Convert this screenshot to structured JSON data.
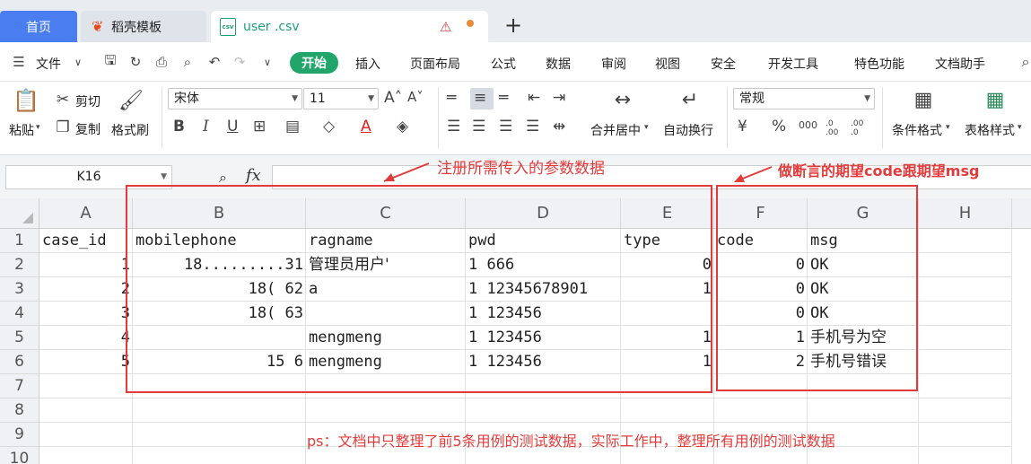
{
  "tabs": {
    "home": "首页",
    "template": "稻壳模板",
    "file": "user .csv",
    "file_icon_text": "csv"
  },
  "menu": {
    "file": "文件",
    "items": [
      "开始",
      "插入",
      "页面布局",
      "公式",
      "数据",
      "审阅",
      "视图",
      "安全",
      "开发工具",
      "特色功能",
      "文档助手"
    ]
  },
  "ribbon": {
    "paste": "粘贴",
    "cut": "剪切",
    "copy": "复制",
    "format_painter": "格式刷",
    "font_name": "宋体",
    "font_size": "11",
    "merge_center": "合并居中",
    "wrap_text": "自动换行",
    "number_format": "常规",
    "conditional_format": "条件格式",
    "table_style": "表格样式",
    "percent_symbol": "%",
    "thousands": "000",
    "inc_decimal": ".0 .00",
    "dec_decimal": ".00 .0"
  },
  "formula_bar": {
    "cell_ref": "K16",
    "fx": "fx",
    "value": ""
  },
  "sheet": {
    "columns": [
      "A",
      "B",
      "C",
      "D",
      "E",
      "F",
      "G",
      "H"
    ],
    "rows": [
      "1",
      "2",
      "3",
      "4",
      "5",
      "6",
      "7",
      "8",
      "9",
      "10"
    ],
    "cells": {
      "r1": [
        "case_id",
        "mobilephone",
        "ragname",
        "pwd",
        "type",
        "code",
        "msg"
      ],
      "r2": [
        "1",
        "18.........31",
        "管理员用户'",
        "1      666",
        "0",
        "0",
        "OK"
      ],
      "r3": [
        "2",
        "18(          62",
        "a",
        "1      12345678901",
        "1",
        "0",
        "OK"
      ],
      "r4": [
        "3",
        "18(          63",
        "",
        "1      123456",
        "",
        "0",
        "OK"
      ],
      "r5": [
        "4",
        "",
        "mengmeng",
        "1      123456",
        "1",
        "1",
        "手机号为空"
      ],
      "r6": [
        "5",
        "15           6",
        "mengmeng",
        "1      123456",
        "1",
        "2",
        "手机号错误"
      ]
    }
  },
  "annotations": {
    "params": "注册所需传入的参数数据",
    "assertion": "做断言的期望code跟期望msg",
    "note": "ps：文档中只整理了前5条用例的测试数据，实际工作中，整理所有用例的测试数据"
  },
  "colors": {
    "accent_green": "#22a56a",
    "home_tab_blue": "#4a7ef0",
    "annotation_red": "#e23b3b"
  }
}
